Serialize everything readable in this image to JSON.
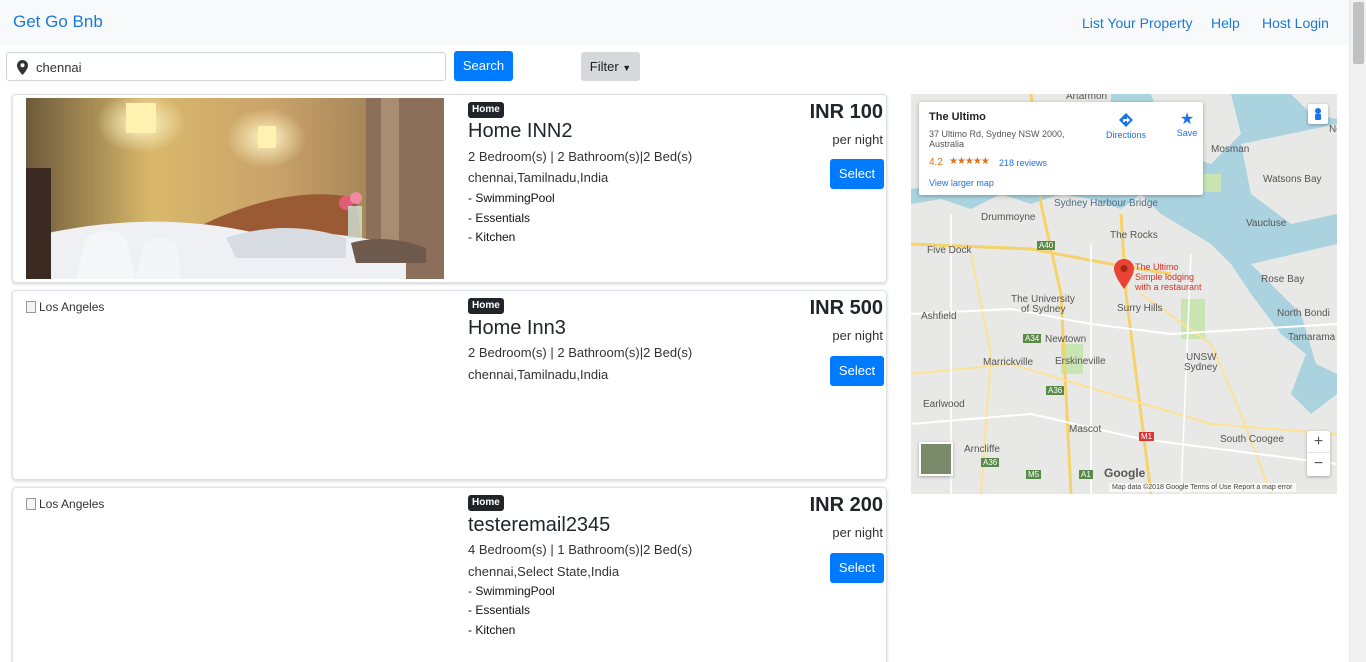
{
  "navbar": {
    "brand": "Get Go Bnb",
    "links": [
      "List Your Property",
      "Help",
      "Host Login"
    ]
  },
  "search": {
    "value": "chennai",
    "button_label": "Search",
    "filter_label": "Filter"
  },
  "listings": [
    {
      "badge": "Home",
      "title": "Home INN2",
      "details": "2 Bedroom(s) | 2 Bathroom(s)|2 Bed(s)",
      "location": "chennai,Tamilnadu,India",
      "amenities": [
        "- SwimmingPool",
        "- Essentials",
        "- Kitchen"
      ],
      "price": "INR 100",
      "per_night": "per night",
      "button": "Select",
      "image_alt": ""
    },
    {
      "badge": "Home",
      "title": "Home Inn3",
      "details": "2 Bedroom(s) | 2 Bathroom(s)|2 Bed(s)",
      "location": "chennai,Tamilnadu,India",
      "amenities": [],
      "price": "INR 500",
      "per_night": "per night",
      "button": "Select",
      "image_alt": "Los Angeles"
    },
    {
      "badge": "Home",
      "title": "testeremail2345",
      "details": "4 Bedroom(s) | 1 Bathroom(s)|2 Bed(s)",
      "location": "chennai,Select State,India",
      "amenities": [
        "- SwimmingPool",
        "- Essentials",
        "- Kitchen"
      ],
      "price": "INR 200",
      "per_night": "per night",
      "button": "Select",
      "image_alt": "Los Angeles"
    }
  ],
  "map": {
    "place_name": "The Ultimo",
    "address": "37 Ultimo Rd, Sydney NSW 2000, Australia",
    "rating": "4.2",
    "stars": "★★★★★",
    "reviews": "218 reviews",
    "view_larger": "View larger map",
    "directions": "Directions",
    "save": "Save",
    "pin_title": "The Ultimo",
    "pin_subtitle": "Simple lodging",
    "pin_subtitle2": "with a restaurant",
    "labels": {
      "artarmon": "Artarmon",
      "mosman": "Mosman",
      "watsons_bay": "Watsons Bay",
      "drummoyne": "Drummoyne",
      "harbour_bridge": "Sydney Harbour Bridge",
      "vaucluse": "Vaucluse",
      "five_dock": "Five Dock",
      "the_rocks": "The Rocks",
      "rose_bay": "Rose Bay",
      "a40": "A40",
      "university": "The University",
      "of_sydney": "of Sydney",
      "ashfield": "Ashfield",
      "surry_hills": "Surry Hills",
      "north_bondi": "North Bondi",
      "a34": "A34",
      "newtown": "Newtown",
      "tamarama": "Tamarama",
      "marrickville": "Marrickville",
      "erskineville": "Erskineville",
      "unsw": "UNSW",
      "sydney": "Sydney",
      "earlwood": "Earlwood",
      "a36": "A36",
      "mascot": "Mascot",
      "m1": "M1",
      "south_coogee": "South Coogee",
      "arncliffe": "Arncliffe",
      "a36b": "A36",
      "m5": "M5",
      "a1": "A1",
      "nor": "Nor"
    },
    "zoom_in": "+",
    "zoom_out": "−",
    "google": "Google",
    "attribution": "Map data ©2018 Google   Terms of Use   Report a map error"
  },
  "colors": {
    "brand": "#1a7ad9",
    "primary_button": "#007bff",
    "filter_button": "#d6d8db",
    "badge": "#212529"
  },
  "icons": {
    "search_pin": "map-marker-icon",
    "filter_caret": "caret-down-icon"
  }
}
